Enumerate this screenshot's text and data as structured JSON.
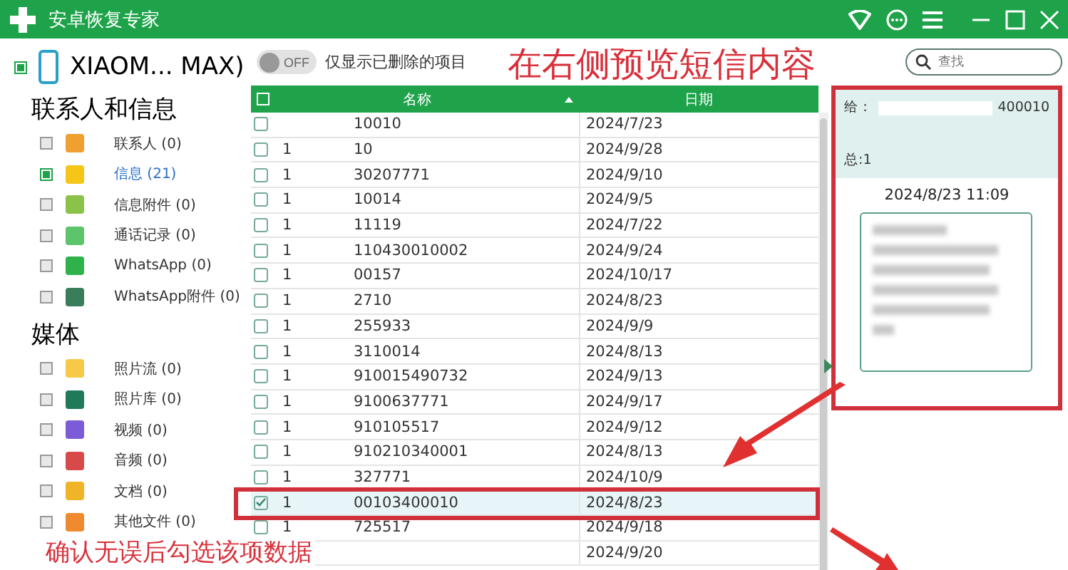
{
  "window": {
    "title": "安卓恢复专家"
  },
  "device": {
    "name": "XIAOM... MAX)",
    "checked": true
  },
  "toggle": {
    "state": "OFF",
    "on": false,
    "label": "仅显示已删除的项目"
  },
  "search": {
    "placeholder": "查找"
  },
  "sidebar": [
    {
      "title": "联系人和信息",
      "items": [
        {
          "label": "联系人 (0)",
          "kind": "contact",
          "checked": false,
          "selected": false
        },
        {
          "label": "信息 (21)",
          "kind": "message",
          "checked": true,
          "selected": true
        },
        {
          "label": "信息附件 (0)",
          "kind": "attachment",
          "checked": false,
          "selected": false
        },
        {
          "label": "通话记录 (0)",
          "kind": "call",
          "checked": false,
          "selected": false
        },
        {
          "label": "WhatsApp (0)",
          "kind": "whatsapp",
          "checked": false,
          "selected": false
        },
        {
          "label": "WhatsApp附件 (0)",
          "kind": "whatsapp-attachment",
          "checked": false,
          "selected": false
        }
      ]
    },
    {
      "title": "媒体",
      "items": [
        {
          "label": "照片流 (0)",
          "kind": "photostream",
          "checked": false,
          "selected": false
        },
        {
          "label": "照片库 (0)",
          "kind": "gallery",
          "checked": false,
          "selected": false
        },
        {
          "label": "视频 (0)",
          "kind": "video",
          "checked": false,
          "selected": false
        },
        {
          "label": "音频 (0)",
          "kind": "audio",
          "checked": false,
          "selected": false
        },
        {
          "label": "文档 (0)",
          "kind": "document",
          "checked": false,
          "selected": false
        },
        {
          "label": "其他文件 (0)",
          "kind": "other",
          "checked": false,
          "selected": false
        }
      ]
    }
  ],
  "table": {
    "columns": [
      "名称",
      "日期"
    ],
    "rows": [
      {
        "column_1": "",
        "name": "10010",
        "date": "2024/7/23",
        "checked": false,
        "selected": false
      },
      {
        "column_1": "1",
        "name": "10",
        "date": "2024/9/28",
        "checked": false,
        "selected": false
      },
      {
        "column_1": "1",
        "name": "30207771",
        "date": "2024/9/10",
        "checked": false,
        "selected": false
      },
      {
        "column_1": "1",
        "name": "10014",
        "date": "2024/9/5",
        "checked": false,
        "selected": false
      },
      {
        "column_1": "1",
        "name": "11119",
        "date": "2024/7/22",
        "checked": false,
        "selected": false
      },
      {
        "column_1": "1",
        "name": "110430010002",
        "date": "2024/9/24",
        "checked": false,
        "selected": false
      },
      {
        "column_1": "1",
        "name": "00157",
        "date": "2024/10/17",
        "checked": false,
        "selected": false
      },
      {
        "column_1": "1",
        "name": "2710",
        "date": "2024/8/23",
        "checked": false,
        "selected": false
      },
      {
        "column_1": "1",
        "name": "255933",
        "date": "2024/9/9",
        "checked": false,
        "selected": false
      },
      {
        "column_1": "1",
        "name": "3110014",
        "date": "2024/8/13",
        "checked": false,
        "selected": false
      },
      {
        "column_1": "1",
        "name": "910015490732",
        "date": "2024/9/13",
        "checked": false,
        "selected": false
      },
      {
        "column_1": "1",
        "name": "9100637771",
        "date": "2024/9/17",
        "checked": false,
        "selected": false
      },
      {
        "column_1": "1",
        "name": "910105517",
        "date": "2024/9/12",
        "checked": false,
        "selected": false
      },
      {
        "column_1": "1",
        "name": "910210340001",
        "date": "2024/8/13",
        "checked": false,
        "selected": false
      },
      {
        "column_1": "1",
        "name": "327771",
        "date": "2024/10/9",
        "checked": false,
        "selected": false
      },
      {
        "column_1": "1",
        "name": "00103400010",
        "date": "2024/8/23",
        "checked": true,
        "selected": true
      },
      {
        "column_1": "1",
        "name": "725517",
        "date": "2024/9/18",
        "checked": false,
        "selected": false
      },
      {
        "date": "2024/9/20"
      }
    ],
    "select_all": false
  },
  "preview": {
    "to_label": "给：",
    "to_number": "400010",
    "total": "总:1",
    "time": "2024/8/23 11:09"
  },
  "annotations": [
    "在右侧预览短信内容",
    "确认无误后勾选该项数据"
  ]
}
